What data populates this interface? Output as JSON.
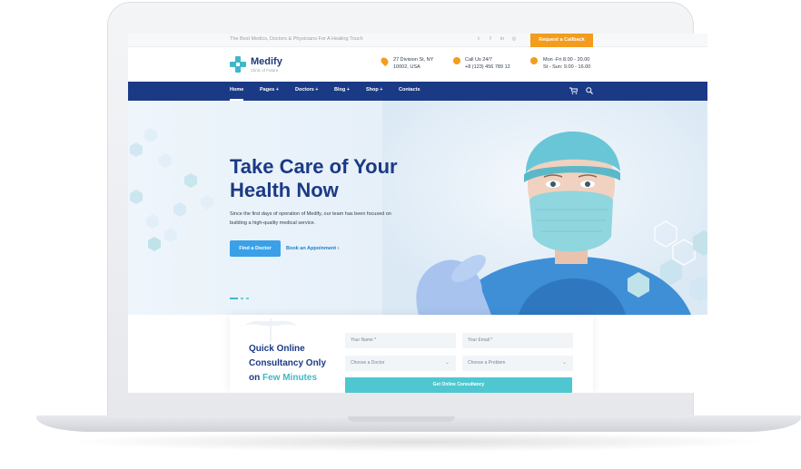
{
  "topbar": {
    "tagline": "The Best Medics, Doctors & Physicians For A Healing Touch",
    "social_icons": [
      "twitter-icon",
      "facebook-icon",
      "linkedin-icon",
      "instagram-icon"
    ],
    "social_glyphs": [
      "t",
      "f",
      "in",
      "◎"
    ],
    "callback_label": "Request a Callback"
  },
  "header": {
    "logo_name": "Medify",
    "logo_sub": "Clinic of Future",
    "address_line1": "27 Division St, NY",
    "address_line2": "10002, USA",
    "call_line1": "Call Us 24/7",
    "call_line2": "+8 (123) 456 789 12",
    "hours_line1": "Mon -Fri 8.00 - 20.00",
    "hours_line2": "St - Sun: 9.00 - 16.00"
  },
  "nav": {
    "items": [
      "Home",
      "Pages +",
      "Doctors +",
      "Blog +",
      "Shop +",
      "Contacts"
    ],
    "active": "Home",
    "cart_glyph": "🛒",
    "search_glyph": "⌕"
  },
  "hero": {
    "title_line1": "Take Care of Your",
    "title_line2": "Health Now",
    "description": "Since the first days of operation of Medify, our team has been focused on building a high-quality medical service.",
    "primary_button": "Find a Doctor",
    "secondary_link": "Book an Appoinment  ›",
    "active_slide": 1,
    "slide_count": 3
  },
  "consult": {
    "title_line1": "Quick Online",
    "title_line2": "Consultancy Only",
    "title_line3_prefix": "on ",
    "title_line3_highlight": "Few Minutes",
    "name_placeholder": "Your Name *",
    "email_placeholder": "Your Email *",
    "doctor_select": "Choose a Doctor",
    "problem_select": "Choose a Problem",
    "submit_label": "Get Online Consultancy"
  },
  "colors": {
    "brand_navy": "#1b3a86",
    "accent_teal": "#3fb8c9",
    "accent_orange": "#f39c1d",
    "button_blue": "#3aa0e8"
  }
}
